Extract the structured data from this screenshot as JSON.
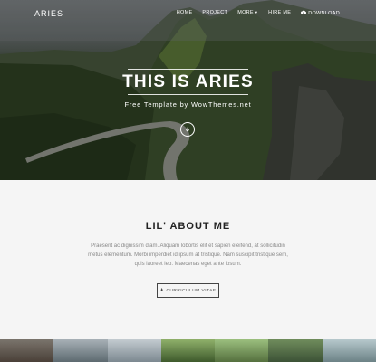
{
  "nav": {
    "brand": "ARIES",
    "items": [
      {
        "label": "HOME"
      },
      {
        "label": "PROJECT"
      },
      {
        "label": "MORE"
      },
      {
        "label": "HIRE ME"
      },
      {
        "label": "DOWNLOAD"
      }
    ]
  },
  "hero": {
    "title": "THIS IS ARIES",
    "subtitle": "Free Template by WowThemes.net"
  },
  "about": {
    "title": "LIL' ABOUT ME",
    "text": "Praesent ac dignissim diam. Aliquam lobortis elit et sapien eleifend, at sollicitudin metus elementum. Morbi imperdiet id ipsum at tristique. Nam suscipit tristique sem, quis laoreet leo. Maecenas eget ante ipsum.",
    "button_label": "CURRICULUM VITAE"
  },
  "gallery": {
    "tile_colors": [
      "#5a5048",
      "#7d8890",
      "#9aa6ae",
      "#4e6a3a",
      "#6f8a5e",
      "#556b52",
      "#8aa0a6"
    ]
  }
}
